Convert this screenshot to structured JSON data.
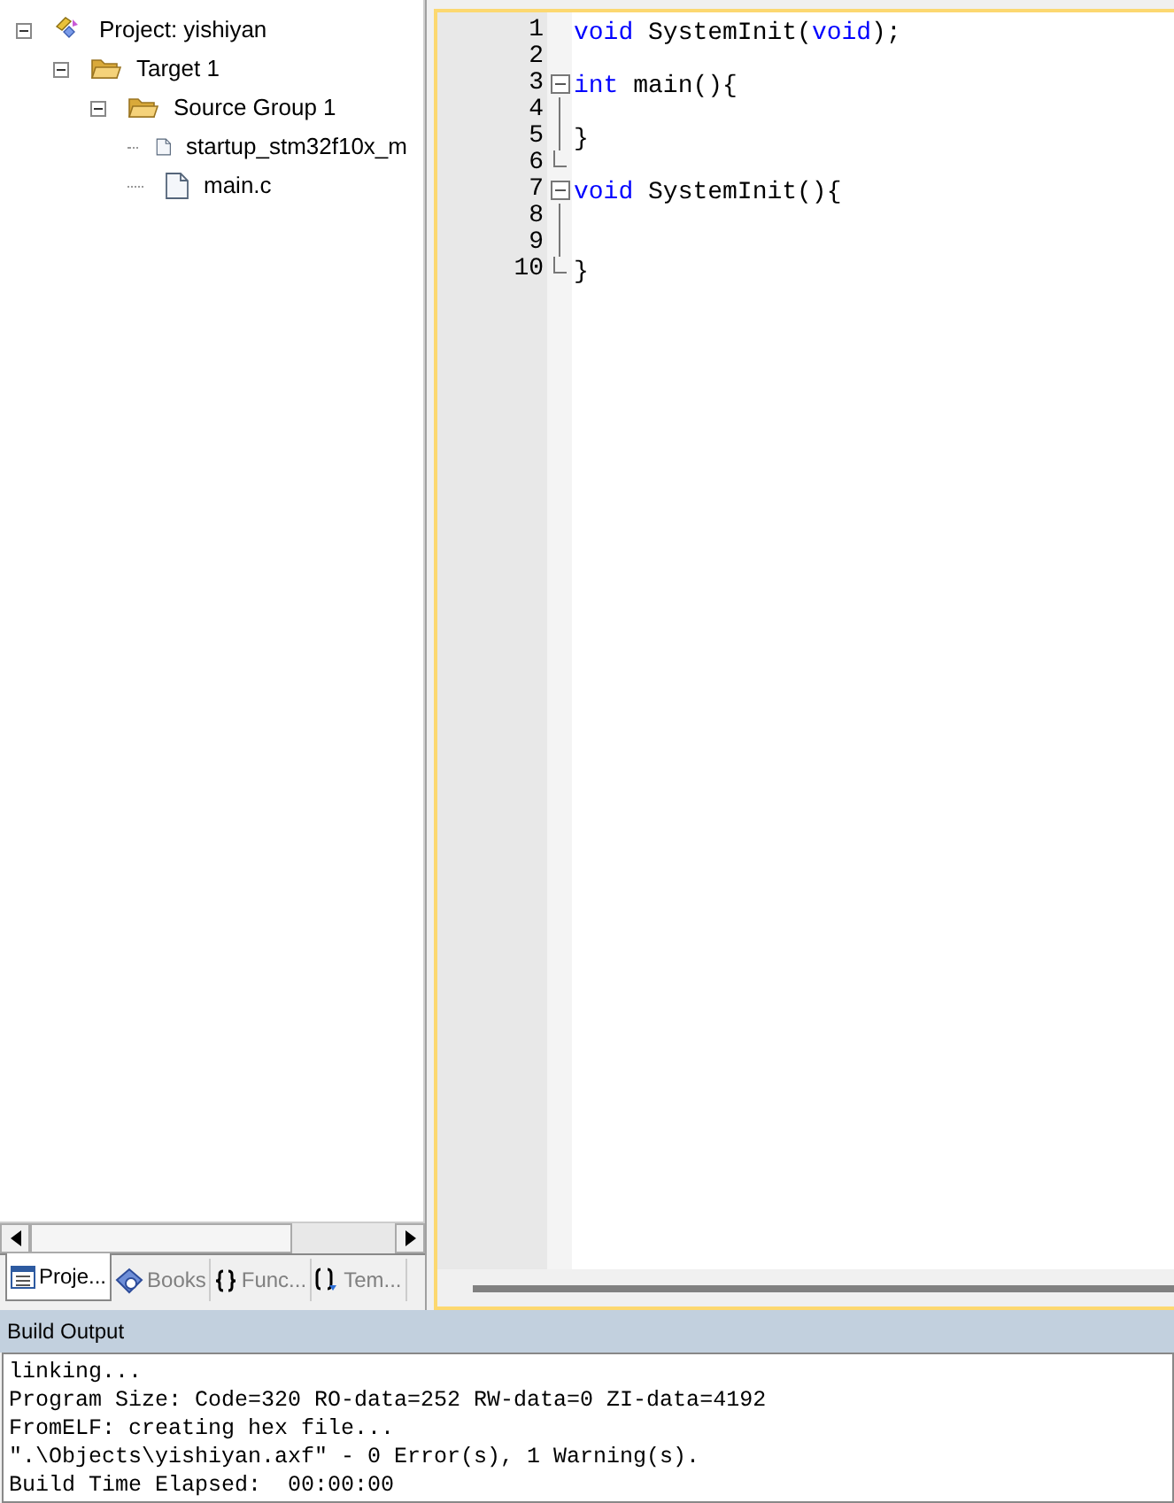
{
  "project_tree": [
    {
      "label": "Project: yishiyan",
      "kind": "project",
      "expanded": true,
      "children": [
        {
          "label": "Target 1",
          "kind": "target",
          "expanded": true,
          "children": [
            {
              "label": "Source Group 1",
              "kind": "group",
              "expanded": true,
              "children": [
                {
                  "label": "startup_stm32f10x_m",
                  "kind": "file"
                },
                {
                  "label": "main.c",
                  "kind": "file"
                }
              ]
            }
          ]
        }
      ]
    }
  ],
  "panel_tabs": [
    {
      "label": "Proje...",
      "kind": "project",
      "selected": true
    },
    {
      "label": "Books",
      "kind": "books",
      "selected": false
    },
    {
      "label": "Func...",
      "kind": "functions",
      "selected": false
    },
    {
      "label": "Tem...",
      "kind": "templates",
      "selected": false
    }
  ],
  "editor": {
    "lines": [
      {
        "number": "1",
        "fold_start": false,
        "fold_end": false,
        "tokens": [
          {
            "text": "void",
            "kind": "keyword"
          },
          {
            "text": " SystemInit(",
            "kind": "plain"
          },
          {
            "text": "void",
            "kind": "keyword"
          },
          {
            "text": ");",
            "kind": "plain"
          }
        ]
      },
      {
        "number": "2",
        "fold_start": false,
        "fold_end": false
      },
      {
        "number": "3",
        "fold_start": true,
        "fold_end": false,
        "tokens": [
          {
            "text": "int",
            "kind": "keyword"
          },
          {
            "text": " main(){",
            "kind": "plain"
          }
        ]
      },
      {
        "number": "4",
        "fold_start": false,
        "fold_end": false
      },
      {
        "number": "5",
        "fold_start": false,
        "fold_end": false,
        "tokens": [
          {
            "text": "}",
            "kind": "plain"
          }
        ]
      },
      {
        "number": "6",
        "fold_start": false,
        "fold_end": true
      },
      {
        "number": "7",
        "fold_start": true,
        "fold_end": false,
        "tokens": [
          {
            "text": "void",
            "kind": "keyword"
          },
          {
            "text": " SystemInit(){",
            "kind": "plain"
          }
        ]
      },
      {
        "number": "8",
        "fold_start": false,
        "fold_end": false
      },
      {
        "number": "9",
        "fold_start": false,
        "fold_end": false
      },
      {
        "number": "10",
        "fold_start": false,
        "fold_end": true,
        "tokens": [
          {
            "text": "}",
            "kind": "plain"
          }
        ]
      }
    ]
  },
  "build_output": {
    "title": "Build Output",
    "lines": [
      "linking...",
      "Program Size: Code=320 RO-data=252 RW-data=0 ZI-data=4192",
      "FromELF: creating hex file...",
      "\".\\Objects\\yishiyan.axf\" - 0 Error(s), 1 Warning(s).",
      "Build Time Elapsed:  00:00:00"
    ]
  }
}
